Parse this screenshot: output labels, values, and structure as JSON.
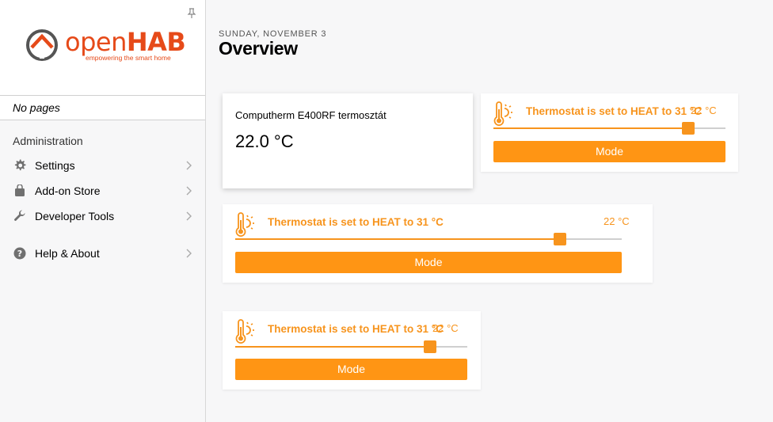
{
  "app": {
    "logo_brand": "openHAB",
    "logo_brand_light": "open",
    "logo_brand_bold": "HAB",
    "logo_tagline": "empowering the smart home",
    "accent_color": "#e64a19"
  },
  "sidebar": {
    "no_pages": "No pages",
    "section_title": "Administration",
    "items": [
      {
        "label": "Settings",
        "icon": "gear-icon"
      },
      {
        "label": "Add-on Store",
        "icon": "shopping-bag-icon"
      },
      {
        "label": "Developer Tools",
        "icon": "wrench-icon"
      },
      {
        "label": "Help & About",
        "icon": "help-circle-icon"
      }
    ]
  },
  "header": {
    "date": "SUNDAY, NOVEMBER 3",
    "title": "Overview"
  },
  "cards": {
    "label_card": {
      "label": "Computherm E400RF termosztát",
      "value": "22.0 °C"
    },
    "thermostats": [
      {
        "label": "Thermostat is set to HEAT to 31 °C",
        "temp": "22 °C",
        "slider_fraction": 0.84,
        "mode_label": "Mode"
      },
      {
        "label": "Thermostat is set to HEAT to 31 °C",
        "temp": "22 °C",
        "slider_fraction": 0.84,
        "mode_label": "Mode"
      },
      {
        "label": "Thermostat is set to HEAT to 31 °C",
        "temp": "22 °C",
        "slider_fraction": 0.84,
        "mode_label": "Mode"
      }
    ],
    "accent_color": "#f7941d"
  }
}
